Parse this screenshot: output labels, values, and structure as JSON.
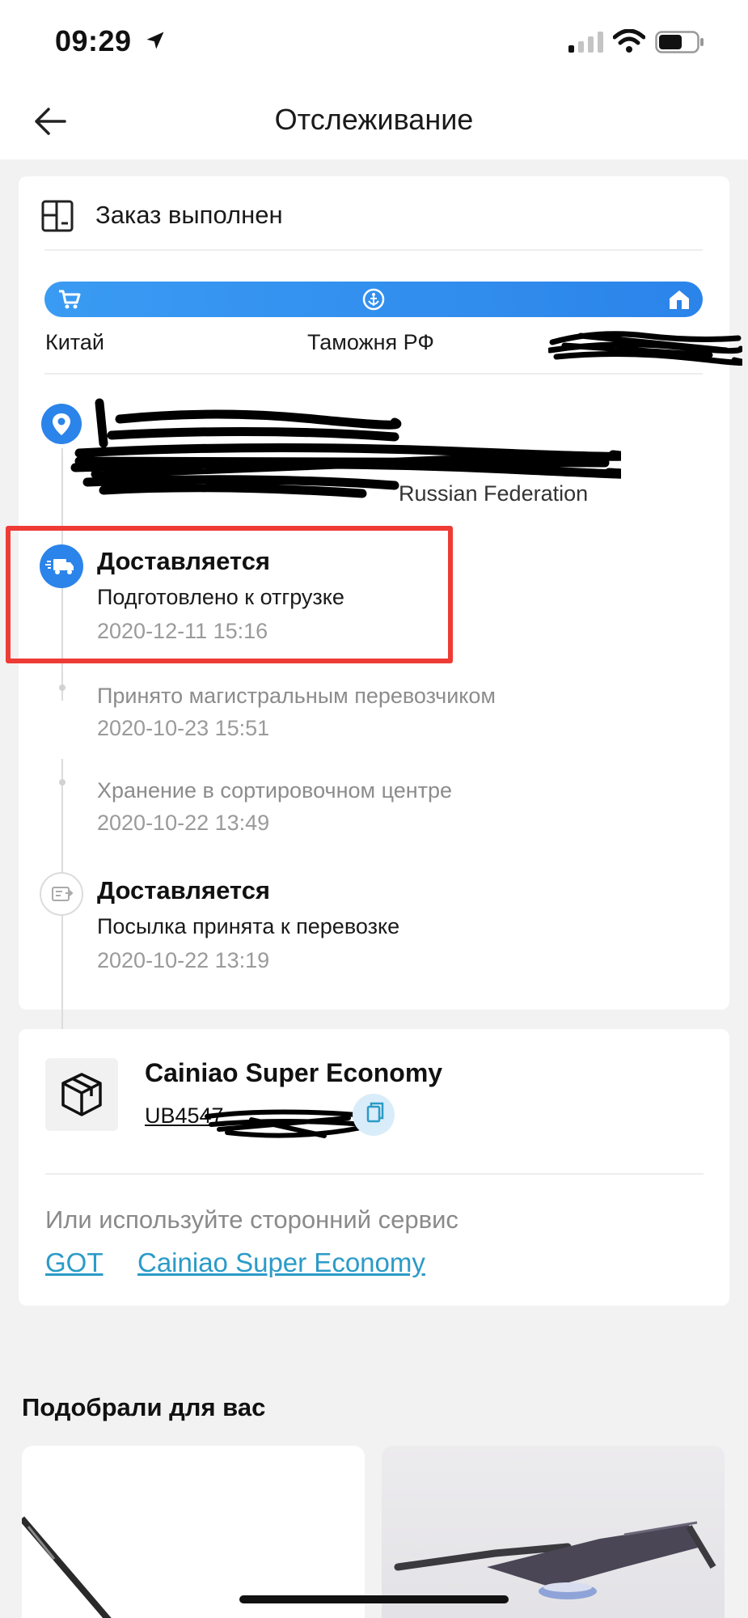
{
  "status_bar": {
    "time": "09:29",
    "icons": [
      "location-arrow-icon",
      "signal-icon",
      "wifi-icon",
      "battery-icon"
    ]
  },
  "header": {
    "title": "Отслеживание",
    "back_icon": "arrow-left-icon"
  },
  "order": {
    "status": "Заказ выполнен",
    "route": {
      "icons": [
        "cart-icon",
        "anchor-icon",
        "home-icon"
      ],
      "origin": "Китай",
      "customs": "Таможня РФ",
      "destination_redacted": true
    },
    "address": {
      "visible_text": "Russian Federation",
      "redacted": true
    }
  },
  "timeline": [
    {
      "title": "Доставляется",
      "description": "Подготовлено к отгрузке",
      "time": "2020-12-11 15:16",
      "icon": "delivery-truck-icon",
      "highlighted": true
    },
    {
      "title": "",
      "description": "Принято магистральным перевозчиком",
      "time": "2020-10-23 15:51"
    },
    {
      "title": "",
      "description": "Хранение в сортировочном центре",
      "time": "2020-10-22 13:49"
    },
    {
      "title": "Доставляется",
      "description": "Посылка принята к перевозке",
      "time": "2020-10-22 13:19",
      "icon": "parcel-icon"
    }
  ],
  "shipment": {
    "carrier": "Cainiao Super Economy",
    "tracking_visible": "UB4547",
    "tracking_redacted": true,
    "copy_icon": "copy-icon",
    "third_party_label": "Или используйте сторонний сервис",
    "links": [
      "GOT",
      "Cainiao Super Economy"
    ]
  },
  "recommendations": {
    "title": "Подобрали для вас",
    "cards": [
      {
        "image": "bike-frame-tube-image"
      },
      {
        "image": "bike-fork-image"
      }
    ]
  },
  "colors": {
    "accent_blue": "#2b84ea",
    "link": "#2b9bc7",
    "highlight_border": "#ee3b35",
    "background": "#f2f2f2"
  }
}
